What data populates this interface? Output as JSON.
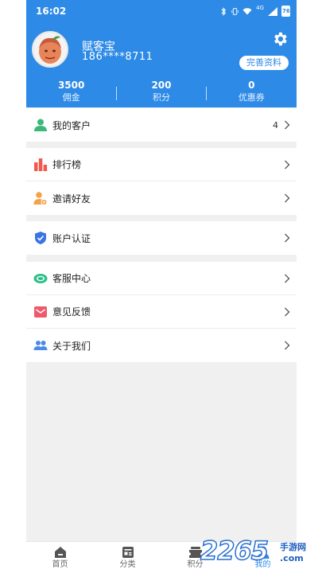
{
  "status_bar": {
    "time": "16:02",
    "network": "4G",
    "battery": "76"
  },
  "profile": {
    "name": "赋客宝",
    "phone": "186****8711",
    "complete_button": "完善资料"
  },
  "stats": [
    {
      "value": "3500",
      "label": "佣金"
    },
    {
      "value": "200",
      "label": "积分"
    },
    {
      "value": "0",
      "label": "优惠券"
    }
  ],
  "menu": {
    "section1": [
      {
        "label": "我的客户",
        "count": "4",
        "icon": "user-icon",
        "color": "#3cb878"
      }
    ],
    "section2": [
      {
        "label": "排行榜",
        "icon": "bar-chart-icon",
        "color": "#ef5a4c"
      },
      {
        "label": "邀请好友",
        "icon": "invite-friend-icon",
        "color": "#f5a146"
      }
    ],
    "section3": [
      {
        "label": "账户认证",
        "icon": "shield-check-icon",
        "color": "#3b73e6"
      }
    ],
    "section4": [
      {
        "label": "客服中心",
        "icon": "headset-icon",
        "color": "#2fbf8a"
      },
      {
        "label": "意见反馈",
        "icon": "feedback-icon",
        "color": "#ef5a6a"
      },
      {
        "label": "关于我们",
        "icon": "group-icon",
        "color": "#4a8ae8"
      }
    ]
  },
  "bottom_nav": [
    {
      "label": "首页",
      "icon": "home-icon"
    },
    {
      "label": "分类",
      "icon": "category-icon"
    },
    {
      "label": "积分",
      "icon": "points-icon"
    },
    {
      "label": "我的",
      "icon": "profile-icon",
      "active": true
    }
  ],
  "watermark": {
    "brand": "2265",
    "suffix": ".com",
    "site_name": "手游网"
  },
  "colors": {
    "primary": "#2d8ae6",
    "background": "#f0f0f0",
    "divider": "#ececec"
  }
}
